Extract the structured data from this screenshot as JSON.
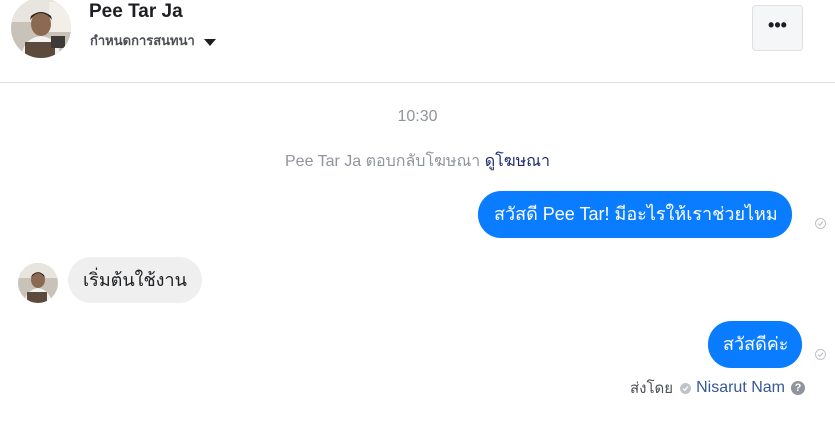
{
  "header": {
    "contact_name": "Pee Tar Ja",
    "settings_label": "กำหนดการสนทนา",
    "more_label": "•••"
  },
  "thread": {
    "timestamp": "10:30",
    "ad_reply_text": "Pee Tar Ja ตอบกลับโฆษณา",
    "ad_link_label": "ดูโฆษณา",
    "messages": [
      {
        "direction": "outgoing",
        "text": "สวัสดี Pee Tar! มีอะไรให้เราช่วยไหม"
      },
      {
        "direction": "incoming",
        "text": "เริ่มต้นใช้งาน"
      },
      {
        "direction": "outgoing",
        "text": "สวัสดีค่ะ"
      }
    ],
    "sent_by": {
      "label": "ส่งโดย",
      "name": "Nisarut Nam",
      "help_icon": "?"
    }
  },
  "colors": {
    "outgoing_bubble": "#0a7cff",
    "incoming_bubble": "#efefef",
    "link": "#365899",
    "muted_text": "#90949c"
  },
  "icons": [
    "avatar",
    "chevron-down-icon",
    "more-options-icon",
    "seen-check-icon",
    "verified-icon",
    "help-icon"
  ]
}
